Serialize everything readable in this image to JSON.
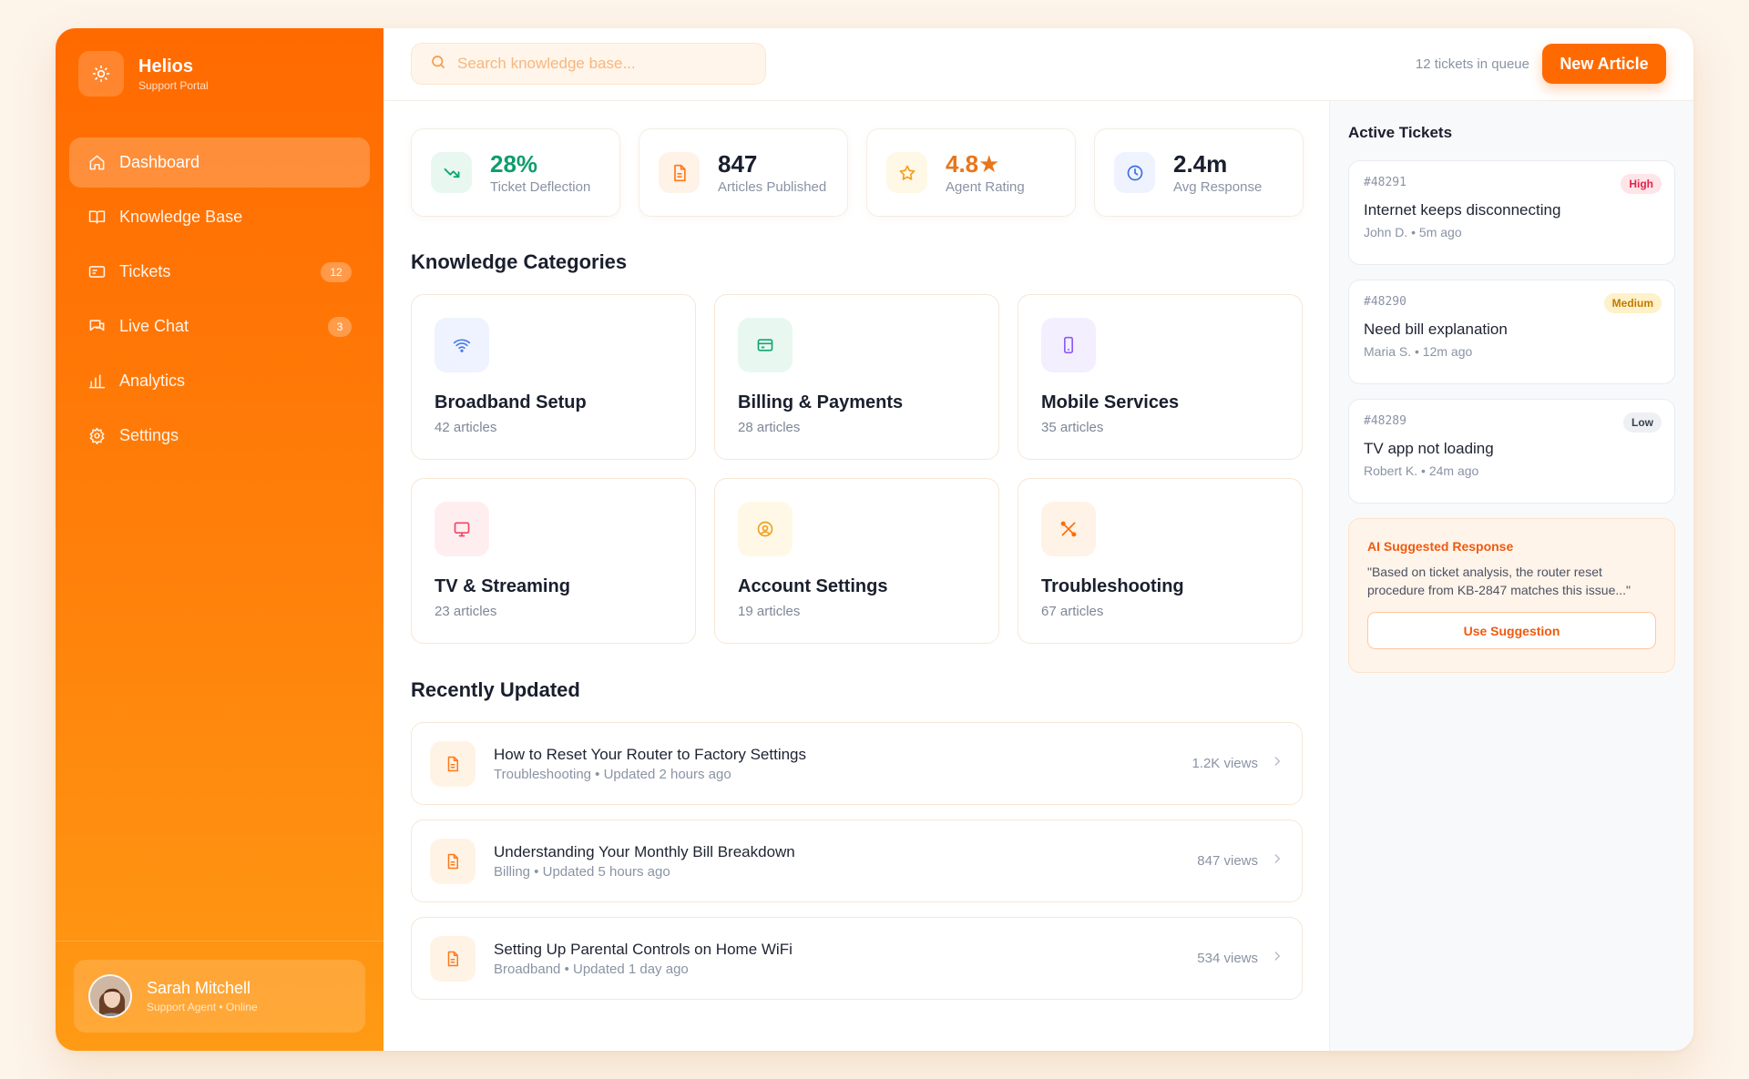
{
  "brand": {
    "name": "Helios",
    "subtitle": "Support Portal",
    "icon": "sun-icon"
  },
  "nav": [
    {
      "label": "Dashboard",
      "icon": "home-icon",
      "active": true,
      "badge": ""
    },
    {
      "label": "Knowledge Base",
      "icon": "book-icon",
      "active": false,
      "badge": ""
    },
    {
      "label": "Tickets",
      "icon": "ticket-icon",
      "active": false,
      "badge": "12"
    },
    {
      "label": "Live Chat",
      "icon": "chat-icon",
      "active": false,
      "badge": "3"
    },
    {
      "label": "Analytics",
      "icon": "bar-chart-icon",
      "active": false,
      "badge": ""
    },
    {
      "label": "Settings",
      "icon": "gear-icon",
      "active": false,
      "badge": ""
    }
  ],
  "user": {
    "name": "Sarah Mitchell",
    "role": "Support Agent • Online"
  },
  "search": {
    "placeholder": "Search knowledge base...",
    "value": ""
  },
  "topbar": {
    "queue_text": "12 tickets in queue",
    "new_button": "New Article"
  },
  "stats": [
    {
      "value": "28%",
      "label": "Ticket Deflection",
      "icon": "trend-down-icon",
      "value_color": "#0f9d6e",
      "icon_bg": "#e8f8f1",
      "icon_color": "#10a674"
    },
    {
      "value": "847",
      "label": "Articles Published",
      "icon": "document-icon",
      "value_color": "#1a1f2e",
      "icon_bg": "#fff2e6",
      "icon_color": "#ff7a1a"
    },
    {
      "value": "4.8★",
      "label": "Agent Rating",
      "icon": "star-icon",
      "value_color": "#e8761a",
      "icon_bg": "#fff8e6",
      "icon_color": "#f0a020"
    },
    {
      "value": "2.4m",
      "label": "Avg Response",
      "icon": "clock-icon",
      "value_color": "#1a1f2e",
      "icon_bg": "#eef3ff",
      "icon_color": "#3b6fe0"
    }
  ],
  "categories_title": "Knowledge Categories",
  "categories": [
    {
      "name": "Broadband Setup",
      "count": "42 articles",
      "icon": "wifi-icon",
      "icon_bg": "#eef3ff",
      "icon_color": "#4a7be8"
    },
    {
      "name": "Billing & Payments",
      "count": "28 articles",
      "icon": "credit-card-icon",
      "icon_bg": "#e8f8f1",
      "icon_color": "#10a674"
    },
    {
      "name": "Mobile Services",
      "count": "35 articles",
      "icon": "smartphone-icon",
      "icon_bg": "#f3efff",
      "icon_color": "#8b5cf6"
    },
    {
      "name": "TV & Streaming",
      "count": "23 articles",
      "icon": "monitor-icon",
      "icon_bg": "#ffeef0",
      "icon_color": "#ef4666"
    },
    {
      "name": "Account Settings",
      "count": "19 articles",
      "icon": "user-circle-icon",
      "icon_bg": "#fff8e6",
      "icon_color": "#f0a020"
    },
    {
      "name": "Troubleshooting",
      "count": "67 articles",
      "icon": "tools-icon",
      "icon_bg": "#fff2e6",
      "icon_color": "#ff6a00"
    }
  ],
  "recent_title": "Recently Updated",
  "articles": [
    {
      "title": "How to Reset Your Router to Factory Settings",
      "meta": "Troubleshooting • Updated 2 hours ago",
      "views": "1.2K views"
    },
    {
      "title": "Understanding Your Monthly Bill Breakdown",
      "meta": "Billing • Updated 5 hours ago",
      "views": "847 views"
    },
    {
      "title": "Setting Up Parental Controls on Home WiFi",
      "meta": "Broadband • Updated 1 day ago",
      "views": "534 views"
    }
  ],
  "tickets_title": "Active Tickets",
  "tickets": [
    {
      "id": "#48291",
      "priority": "High",
      "title": "Internet keeps disconnecting",
      "meta": "John D. • 5m ago",
      "badge_bg": "#ffe4e8",
      "badge_color": "#e0244a"
    },
    {
      "id": "#48290",
      "priority": "Medium",
      "title": "Need bill explanation",
      "meta": "Maria S. • 12m ago",
      "badge_bg": "#fff1c9",
      "badge_color": "#c07a00"
    },
    {
      "id": "#48289",
      "priority": "Low",
      "title": "TV app not loading",
      "meta": "Robert K. • 24m ago",
      "badge_bg": "#eef0f4",
      "badge_color": "#3a4150"
    }
  ],
  "ai": {
    "title": "AI Suggested Response",
    "text": "\"Based on ticket analysis, the router reset procedure from KB-2847 matches this issue...\"",
    "button": "Use Suggestion"
  }
}
